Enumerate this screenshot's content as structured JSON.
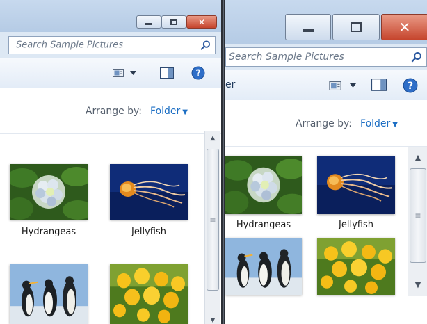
{
  "left_window": {
    "search_placeholder": "Search Sample Pictures",
    "arrange_label": "Arrange by:",
    "arrange_value": "Folder",
    "captions": [
      "Hydrangeas",
      "Jellyfish"
    ]
  },
  "right_window": {
    "search_placeholder": "Search Sample Pictures",
    "toolbar_text": "er",
    "arrange_label": "Arrange by:",
    "arrange_value": "Folder",
    "captions": [
      "Hydrangeas",
      "Jellyfish"
    ]
  },
  "icons": {
    "minimize": "minimize-icon",
    "maximize": "maximize-icon",
    "close": "close-icon",
    "search": "search-icon",
    "view": "change-view-icon",
    "preview_pane": "preview-pane-icon",
    "help": "help-icon",
    "scroll_up": "scroll-up-icon",
    "scroll_down": "scroll-down-icon"
  },
  "colors": {
    "close_button": "#c6452d",
    "arrange_value": "#1d6fc4",
    "titlebar": "#c7d9ee"
  }
}
